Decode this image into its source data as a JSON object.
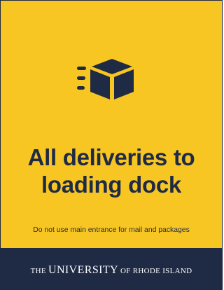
{
  "colors": {
    "background": "#f8c623",
    "ink": "#1f2a44",
    "footer_background": "#1f2a44",
    "footer_text": "#ffffff"
  },
  "icon": {
    "name": "package-delivery-icon"
  },
  "headline": {
    "line1": "All deliveries to",
    "line2": "loading dock"
  },
  "subtext": "Do not use main entrance for mail and packages",
  "footer": {
    "prefix": "THE ",
    "name": "UNIVERSITY",
    "suffix": " OF RHODE ISLAND"
  }
}
